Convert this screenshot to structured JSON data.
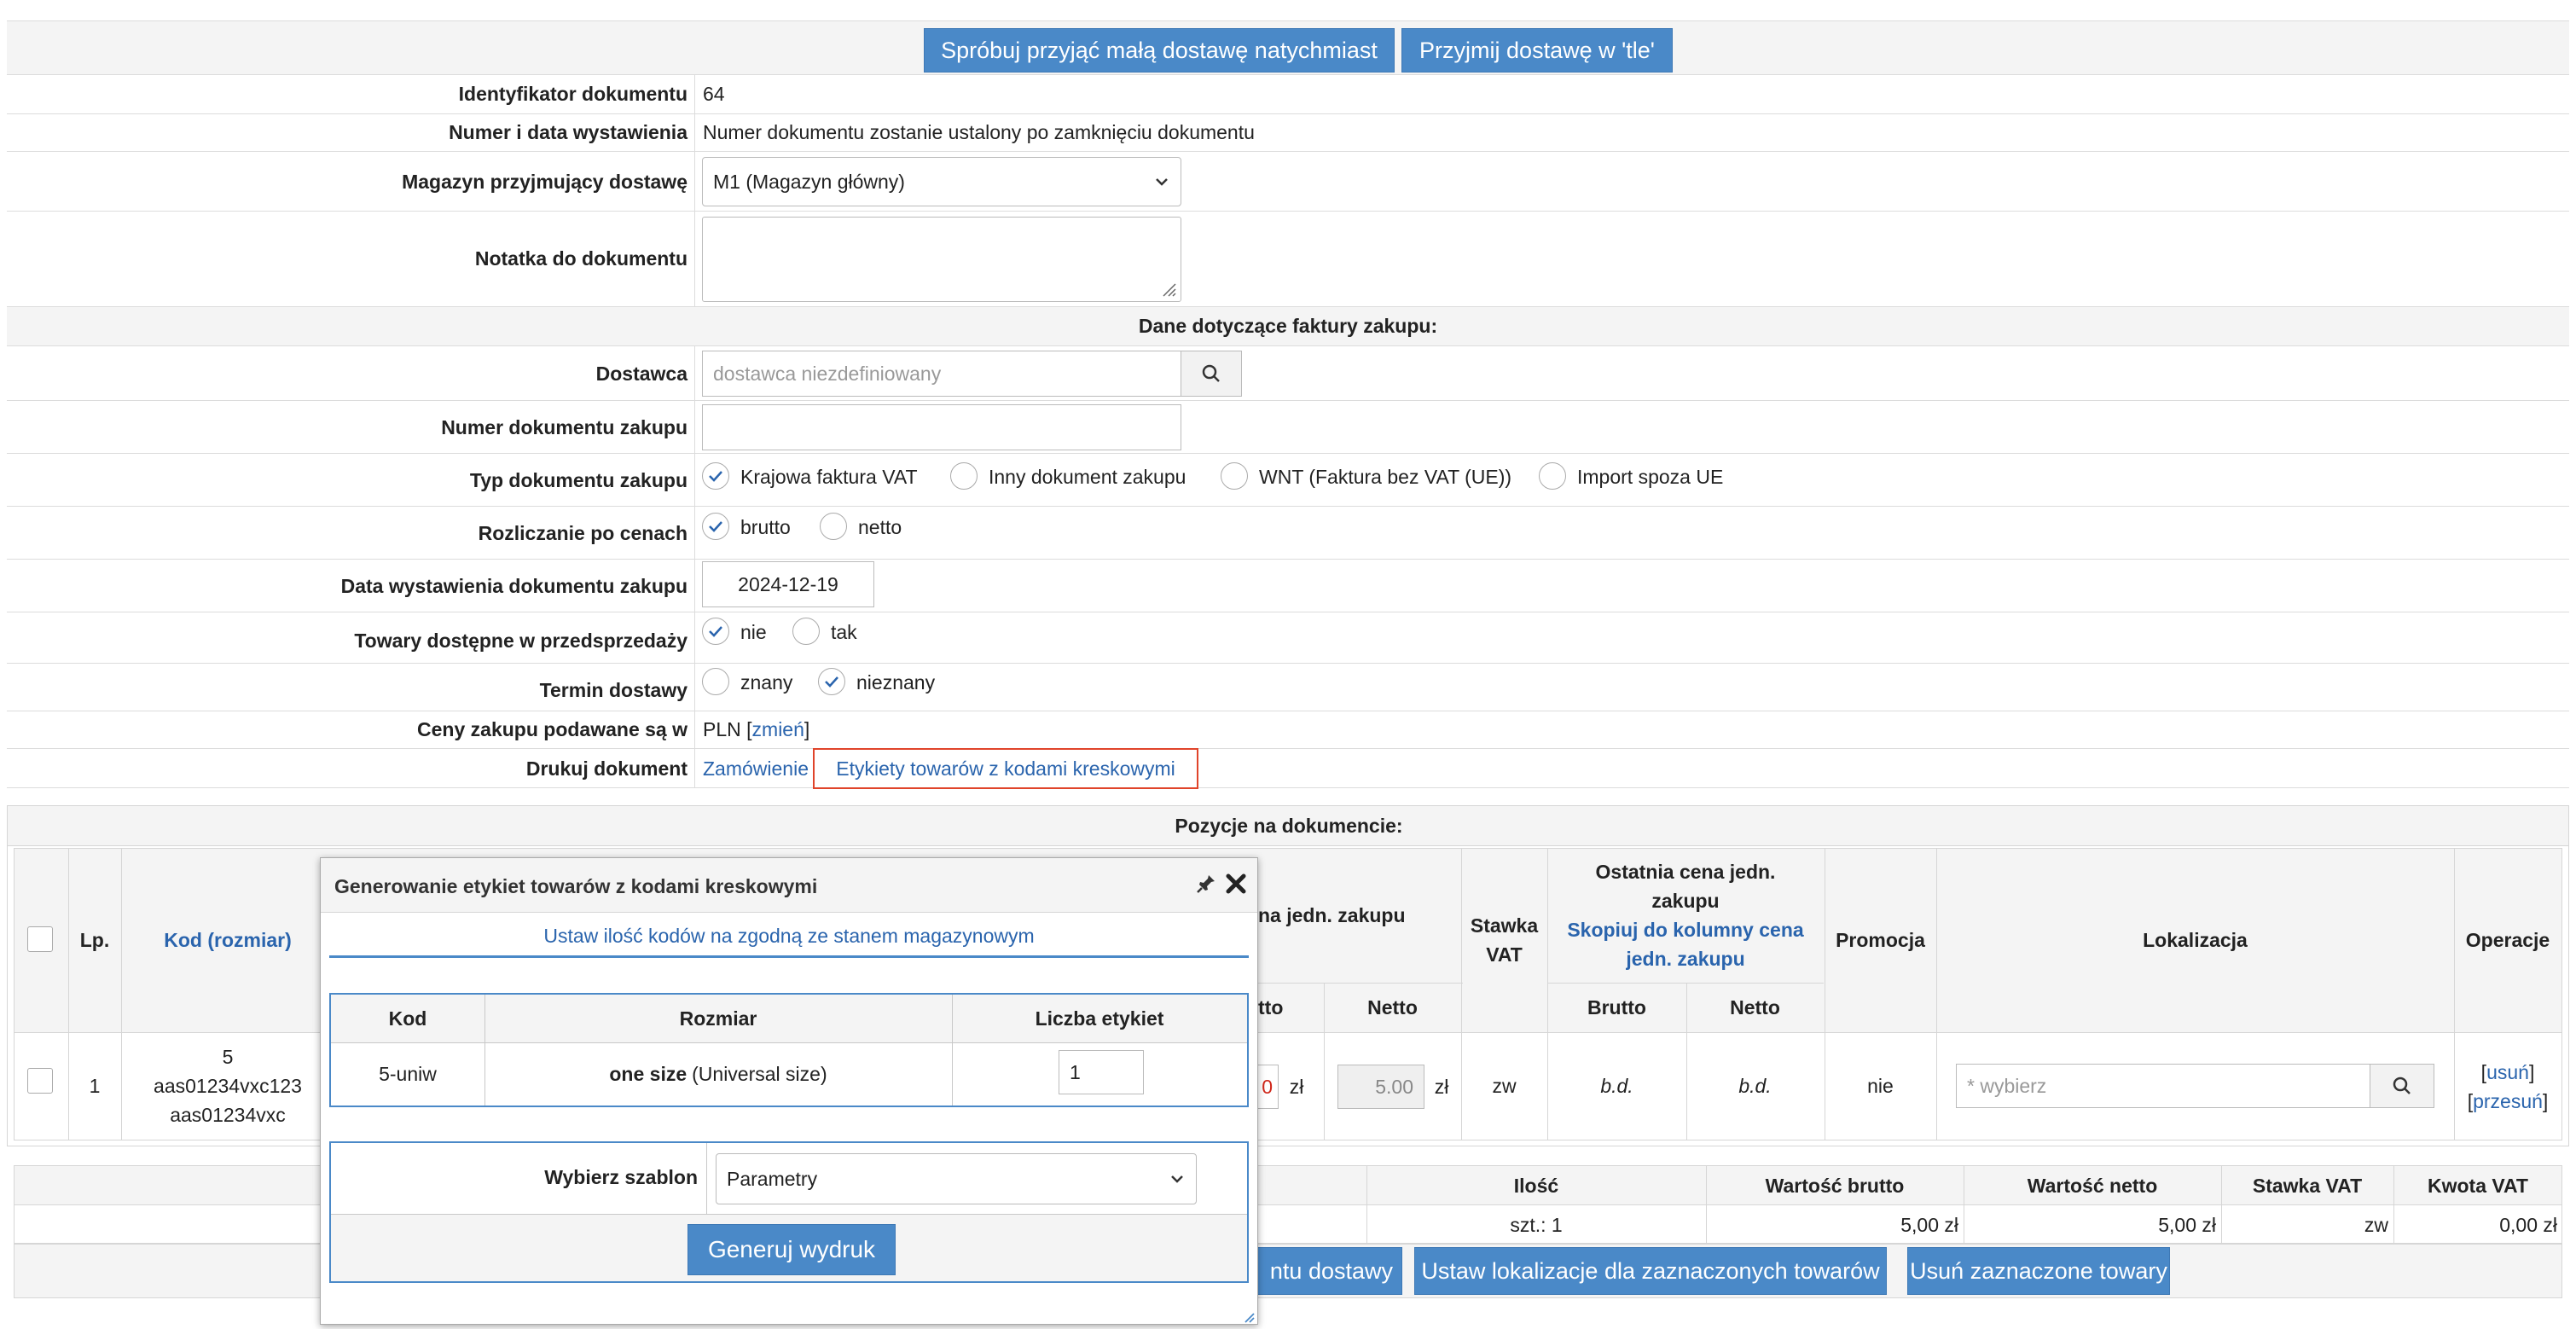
{
  "top_buttons": {
    "accept_small": "Spróbuj przyjąć małą dostawę natychmiast",
    "accept_background": "Przyjmij dostawę w 'tle'"
  },
  "form": {
    "doc_id_label": "Identyfikator dokumentu",
    "doc_id_value": "64",
    "doc_number_label": "Numer i data wystawienia",
    "doc_number_value": "Numer dokumentu zostanie ustalony po zamknięciu dokumentu",
    "warehouse_label": "Magazyn przyjmujący dostawę",
    "warehouse_value": "M1 (Magazyn główny)",
    "note_label": "Notatka do dokumentu",
    "note_value": "",
    "invoice_section": "Dane dotyczące faktury zakupu:",
    "supplier_label": "Dostawca",
    "supplier_placeholder": "dostawca niezdefiniowany",
    "purchase_doc_number_label": "Numer dokumentu zakupu",
    "purchase_doc_number_value": "",
    "purchase_doc_type_label": "Typ dokumentu zakupu",
    "purchase_doc_type_options": [
      "Krajowa faktura VAT",
      "Inny dokument zakupu",
      "WNT (Faktura bez VAT (UE))",
      "Import spoza UE"
    ],
    "purchase_doc_type_selected": 0,
    "pricing_label": "Rozliczanie po cenach",
    "pricing_options": [
      "brutto",
      "netto"
    ],
    "pricing_selected": 0,
    "issue_date_label": "Data wystawienia dokumentu zakupu",
    "issue_date_value": "2024-12-19",
    "presale_label": "Towary dostępne w przedsprzedaży",
    "presale_options": [
      "nie",
      "tak"
    ],
    "presale_selected": 0,
    "delivery_term_label": "Termin dostawy",
    "delivery_term_options": [
      "znany",
      "nieznany"
    ],
    "delivery_term_selected": 1,
    "currency_label": "Ceny zakupu podawane są w",
    "currency_value": "PLN",
    "currency_change_open": "[",
    "currency_change_link": "zmień",
    "currency_change_close": "]",
    "print_label": "Drukuj dokument",
    "print_order_link": "Zamówienie",
    "print_labels_link": "Etykiety towarów z kodami kreskowymi"
  },
  "positions": {
    "section_title": "Pozycje na dokumencie:",
    "headers": {
      "lp": "Lp.",
      "kod": "Kod (rozmiar)",
      "price_group": "na jedn. zakupu",
      "brutto_partial": "tto",
      "netto": "Netto",
      "vat_line1": "Stawka",
      "vat_line2": "VAT",
      "last_price_line1": "Ostatnia cena jedn.",
      "last_price_line2": "zakupu",
      "copy_line1": "Skopiuj do kolumny cena",
      "copy_line2": "jedn. zakupu",
      "last_brutto": "Brutto",
      "last_netto": "Netto",
      "promo": "Promocja",
      "location": "Lokalizacja",
      "operations": "Operacje"
    },
    "row": {
      "lp": "1",
      "code_line1": "5",
      "code_line2": "aas01234vxc123",
      "code_line3": "aas01234vxc",
      "brutto_partial": "0",
      "currency": "zł",
      "netto_value": "5.00",
      "vat": "zw",
      "last_brutto": "b.d.",
      "last_netto": "b.d.",
      "promo": "nie",
      "location_placeholder": "* wybierz",
      "op_open": "[",
      "op_delete": "usuń",
      "op_move": "przesuń",
      "op_close": "]"
    }
  },
  "summary": {
    "headers": [
      "Ilość",
      "Wartość brutto",
      "Wartość netto",
      "Stawka VAT",
      "Kwota VAT"
    ],
    "values": [
      "szt.: 1",
      "5,00 zł",
      "5,00 zł",
      "zw",
      "0,00 zł"
    ]
  },
  "bottom_buttons": {
    "partial": "ntu dostawy",
    "set_location": "Ustaw lokalizacje dla zaznaczonych towarów",
    "remove_selected": "Usuń zaznaczone towary"
  },
  "modal": {
    "title": "Generowanie etykiet towarów z kodami kreskowymi",
    "set_qty_link": "Ustaw ilość kodów na zgodną ze stanem magazynowym",
    "headers": [
      "Kod",
      "Rozmiar",
      "Liczba etykiet"
    ],
    "row_code": "5-uniw",
    "row_size_bold": "one size",
    "row_size_rest": "(Universal size)",
    "row_count": "1",
    "template_label": "Wybierz szablon",
    "template_value": "Parametry",
    "generate_button": "Generuj wydruk"
  },
  "colors": {
    "primary_button": "#4a89c8",
    "link": "#2a64ad",
    "highlight_border": "#e0442a",
    "modal_border": "#4a89c8"
  }
}
